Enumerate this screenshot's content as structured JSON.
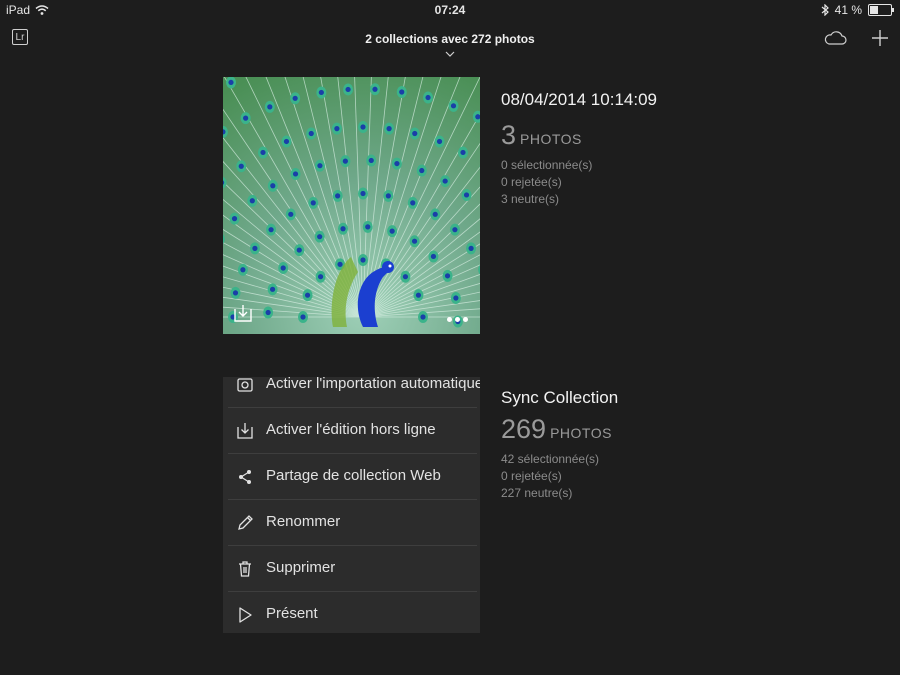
{
  "status_bar": {
    "carrier": "iPad",
    "time": "07:24",
    "battery": "41 %",
    "battery_level": 0.41
  },
  "header": {
    "title": "2 collections avec 272 photos"
  },
  "collections": [
    {
      "name": "08/04/2014 10:14:09",
      "count": "3",
      "count_unit": "PHOTOS",
      "selected": "0 sélectionnée(s)",
      "rejected": "0 rejetée(s)",
      "neutral": "3 neutre(s)"
    },
    {
      "name": "Sync Collection",
      "count": "269",
      "count_unit": "PHOTOS",
      "selected": "42 sélectionnée(s)",
      "rejected": "0 rejetée(s)",
      "neutral": "227 neutre(s)"
    }
  ],
  "menu": {
    "items": [
      {
        "label": "Activer l'importation automatique",
        "icon": "camera-icon"
      },
      {
        "label": "Activer l'édition hors ligne",
        "icon": "download-icon"
      },
      {
        "label": "Partage de collection Web",
        "icon": "share-icon"
      },
      {
        "label": "Renommer",
        "icon": "pencil-icon"
      },
      {
        "label": "Supprimer",
        "icon": "trash-icon"
      },
      {
        "label": "Présent",
        "icon": "play-icon"
      }
    ]
  },
  "colors": {
    "background": "#1d1d1d",
    "menu_background": "#2c2c2c",
    "text_primary": "#e8e8e8",
    "text_muted": "#8c8c8c"
  }
}
